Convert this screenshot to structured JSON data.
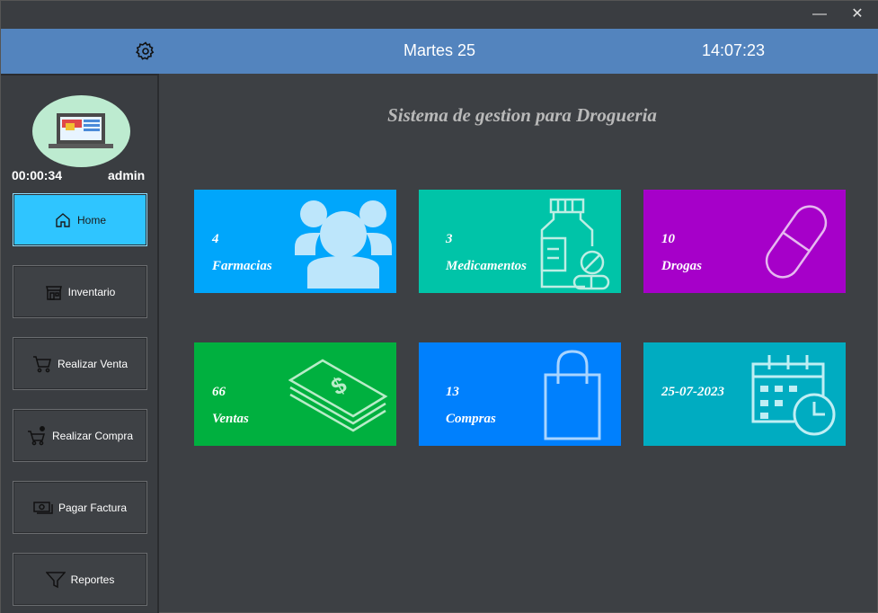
{
  "window": {
    "minimize": "—",
    "close": "✕"
  },
  "topbar": {
    "date": "Martes 25",
    "time": "14:07:23",
    "settings_icon": "gear-icon"
  },
  "session": {
    "elapsed": "00:00:34",
    "user": "admin"
  },
  "sidebar": {
    "items": [
      {
        "label": "Home",
        "icon": "home-icon",
        "active": true
      },
      {
        "label": "Inventario",
        "icon": "store-icon"
      },
      {
        "label": "Realizar Venta",
        "icon": "cart-icon"
      },
      {
        "label": "Realizar Compra",
        "icon": "cart-add-icon"
      },
      {
        "label": "Pagar Factura",
        "icon": "money-icon"
      },
      {
        "label": "Reportes",
        "icon": "filter-icon"
      }
    ]
  },
  "main": {
    "title": "Sistema de gestion para Drogueria",
    "tiles": [
      {
        "value": "4",
        "label": "Farmacias",
        "color": "#00a6fb",
        "icon": "users-icon"
      },
      {
        "value": "3",
        "label": "Medicamentos",
        "color": "#00c4a8",
        "icon": "medicine-bottle-icon"
      },
      {
        "value": "10",
        "label": "Drogas",
        "color": "#a600c9",
        "icon": "pill-icon"
      },
      {
        "value": "66",
        "label": "Ventas",
        "color": "#00b03f",
        "icon": "money-stack-icon"
      },
      {
        "value": "13",
        "label": "Compras",
        "color": "#0080fd",
        "icon": "shopping-bag-icon"
      },
      {
        "value": "25-07-2023",
        "label": "",
        "color": "#00acc1",
        "icon": "calendar-clock-icon"
      }
    ]
  }
}
